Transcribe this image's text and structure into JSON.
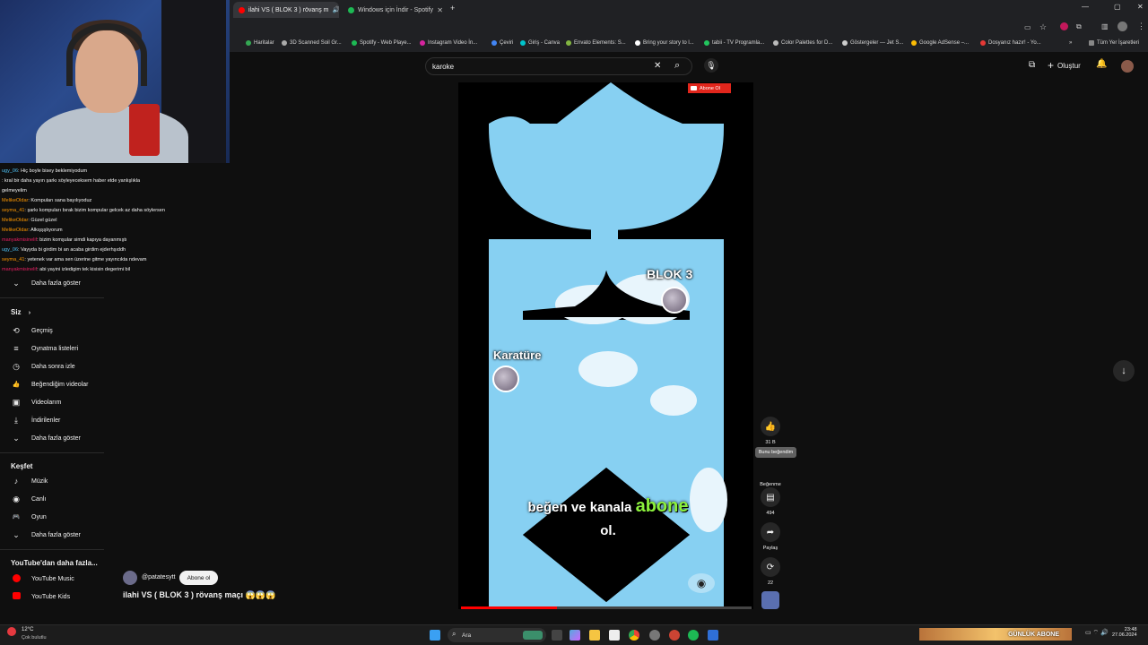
{
  "browser": {
    "tabs": [
      {
        "label": "ilahi VS ( BLOK 3 ) rövanş m",
        "active": true
      },
      {
        "label": "Windows için İndir - Spotify",
        "active": false
      }
    ],
    "new_tab": "+",
    "bookmarks": [
      "Haritalar",
      "3D Scanned Soil Gr...",
      "Spotify - Web Playe...",
      "Instagram Video İn...",
      "Çeviri",
      "Giriş - Canva",
      "Envato Elements: S...",
      "Bring your story to l...",
      "tabii - TV Programla...",
      "Color Palettes for D...",
      "Gösterge­ler — Jet S...",
      "Google AdSense –...",
      "Dosyanız hazır! - Yo...",
      "Tüm Yer İşaretleri"
    ],
    "more_bookmarks": "»"
  },
  "youtube": {
    "search_value": "karoke",
    "create_label": "Oluştur"
  },
  "chat": [
    {
      "user": "ugy_06",
      "msg": ": Hiç boyle bisey beklemiyodum"
    },
    {
      "user": "",
      "msg": ": kral bir daha yayın şarkı söyleyeceksem haber etde yanlışlıkla"
    },
    {
      "user": "",
      "msg": "gelmeyelim"
    },
    {
      "user": "MelikeOldar",
      "msg": ": Kompuları sana bayılıyoduz"
    },
    {
      "user": "seyma_41",
      "msg": ": şarkı kompuları bırak bizim kompular gelcek az daha söylersen"
    },
    {
      "user": "MelikeOldar",
      "msg": ": Güzel güzel"
    },
    {
      "user": "MelikeOldar",
      "msg": ": Alkışşşlıyorum"
    },
    {
      "user": "manyakmisinelif",
      "msg": ": bizim komşular simdi kapıya dayanmıştı"
    },
    {
      "user": "ugy_06",
      "msg": ": Vayyda bi girdim bi an acaba girdim ejderhşıddh"
    },
    {
      "user": "seyma_41",
      "msg": ": yetenek var ama sen üzerine gitme yayıncıkta ndevam"
    },
    {
      "user": "manyakmisinelif",
      "msg": ": abi yayini izledigim tek kisisin degerimi bil"
    }
  ],
  "sidebar": {
    "more1": "Daha fazla göster",
    "you_heading": "Siz",
    "you_items": [
      {
        "icon": "history-icon",
        "glyph": "⟲",
        "label": "Geçmiş"
      },
      {
        "icon": "playlist-icon",
        "glyph": "≡",
        "label": "Oynatma listeleri"
      },
      {
        "icon": "clock-icon",
        "glyph": "◷",
        "label": "Daha sonra izle"
      },
      {
        "icon": "thumbs-up-icon",
        "glyph": "👍",
        "label": "Beğendiğim videolar"
      },
      {
        "icon": "video-icon",
        "glyph": "▣",
        "label": "Videolarım"
      },
      {
        "icon": "download-icon",
        "glyph": "⤓",
        "label": "İndirilenler"
      }
    ],
    "more2": "Daha fazla göster",
    "explore_heading": "Keşfet",
    "explore_items": [
      {
        "icon": "music-icon",
        "glyph": "♪",
        "label": "Müzik"
      },
      {
        "icon": "live-icon",
        "glyph": "◉",
        "label": "Canlı"
      },
      {
        "icon": "gaming-icon",
        "glyph": "🎮",
        "label": "Oyun"
      }
    ],
    "more3": "Daha fazla göster",
    "more_yt_heading": "YouTube'dan daha fazla...",
    "more_yt_items": [
      {
        "icon": "youtube-music-icon",
        "label": "YouTube Music"
      },
      {
        "icon": "youtube-kids-icon",
        "label": "YouTube Kids"
      }
    ]
  },
  "video": {
    "subscribe_overlay": "Abone Ol",
    "player1": "BLOK 3",
    "player2": "Karatüre",
    "subtitle_pre": "beğen ve kanala",
    "subtitle_hl": "abone",
    "subtitle_post": "ol.",
    "progress": 0.33,
    "channel": "@patatesytt",
    "subscribe_button": "Abone ol",
    "title": "ilahi VS ( BLOK 3 ) rövanş maçı 😱😱😱"
  },
  "actions": {
    "like_count": "31 B",
    "tooltip": "Bunu beğendim",
    "dislike_label": "Beğenme",
    "comments": "494",
    "share": "Paylaş",
    "remix": "22"
  },
  "taskbar": {
    "weather_temp": "12°C",
    "weather_desc": "Çok bulutlu",
    "search_placeholder": "Ara",
    "banner": "GÜNLÜK ABONE",
    "time": "23:48",
    "date": "27.06.2024"
  },
  "colors": {
    "accent_red": "#ff0000",
    "sky": "#87d0f2",
    "highlight_green": "#8bf03c"
  }
}
